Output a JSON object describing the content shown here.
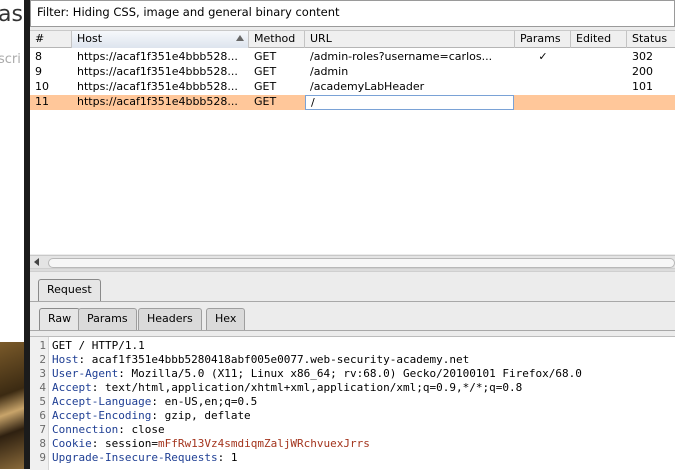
{
  "background": {
    "title_fragment": "as",
    "subtitle_fragment": "scri"
  },
  "filter": {
    "text": "Filter: Hiding CSS, image and general binary content"
  },
  "table": {
    "columns": [
      "#",
      "Host",
      "Method",
      "URL",
      "Params",
      "Edited",
      "Status"
    ],
    "sorted_column": "Host",
    "rows": [
      {
        "num": "8",
        "host": "https://acaf1f351e4bbb528...",
        "method": "GET",
        "url": "/admin-roles?username=carlos...",
        "params": "✓",
        "edited": "",
        "status": "302",
        "selected": false
      },
      {
        "num": "9",
        "host": "https://acaf1f351e4bbb528...",
        "method": "GET",
        "url": "/admin",
        "params": "",
        "edited": "",
        "status": "200",
        "selected": false
      },
      {
        "num": "10",
        "host": "https://acaf1f351e4bbb528...",
        "method": "GET",
        "url": "/academyLabHeader",
        "params": "",
        "edited": "",
        "status": "101",
        "selected": false
      },
      {
        "num": "11",
        "host": "https://acaf1f351e4bbb528...",
        "method": "GET",
        "url": "/",
        "params": "",
        "edited": "",
        "status": "",
        "selected": true
      }
    ]
  },
  "tabs": {
    "request": "Request",
    "subtabs": [
      "Raw",
      "Params",
      "Headers",
      "Hex"
    ],
    "active_subtab": "Raw"
  },
  "editor": {
    "lines": [
      {
        "n": "1",
        "name": "",
        "sep": "",
        "value": "GET / HTTP/1.1"
      },
      {
        "n": "2",
        "name": "Host",
        "sep": ":",
        "value": " acaf1f351e4bbb5280418abf005e0077.web-security-academy.net"
      },
      {
        "n": "3",
        "name": "User-Agent",
        "sep": ":",
        "value": " Mozilla/5.0 (X11; Linux x86_64; rv:68.0) Gecko/20100101 Firefox/68.0"
      },
      {
        "n": "4",
        "name": "Accept",
        "sep": ":",
        "value": " text/html,application/xhtml+xml,application/xml;q=0.9,*/*;q=0.8"
      },
      {
        "n": "5",
        "name": "Accept-Language",
        "sep": ":",
        "value": " en-US,en;q=0.5"
      },
      {
        "n": "6",
        "name": "Accept-Encoding",
        "sep": ":",
        "value": " gzip, deflate"
      },
      {
        "n": "7",
        "name": "Connection",
        "sep": ":",
        "value": " close"
      },
      {
        "n": "8",
        "name": "Cookie",
        "sep": ":",
        "value": " session=",
        "cookie": "mFfRw13Vz4smdiqmZaljWRchvuexJrrs"
      },
      {
        "n": "9",
        "name": "Upgrade-Insecure-Requests",
        "sep": ":",
        "value": " 1"
      }
    ]
  },
  "colors": {
    "selected_row": "#ffc79a",
    "header_name": "#1f3f94",
    "cookie_value": "#a3341d"
  }
}
